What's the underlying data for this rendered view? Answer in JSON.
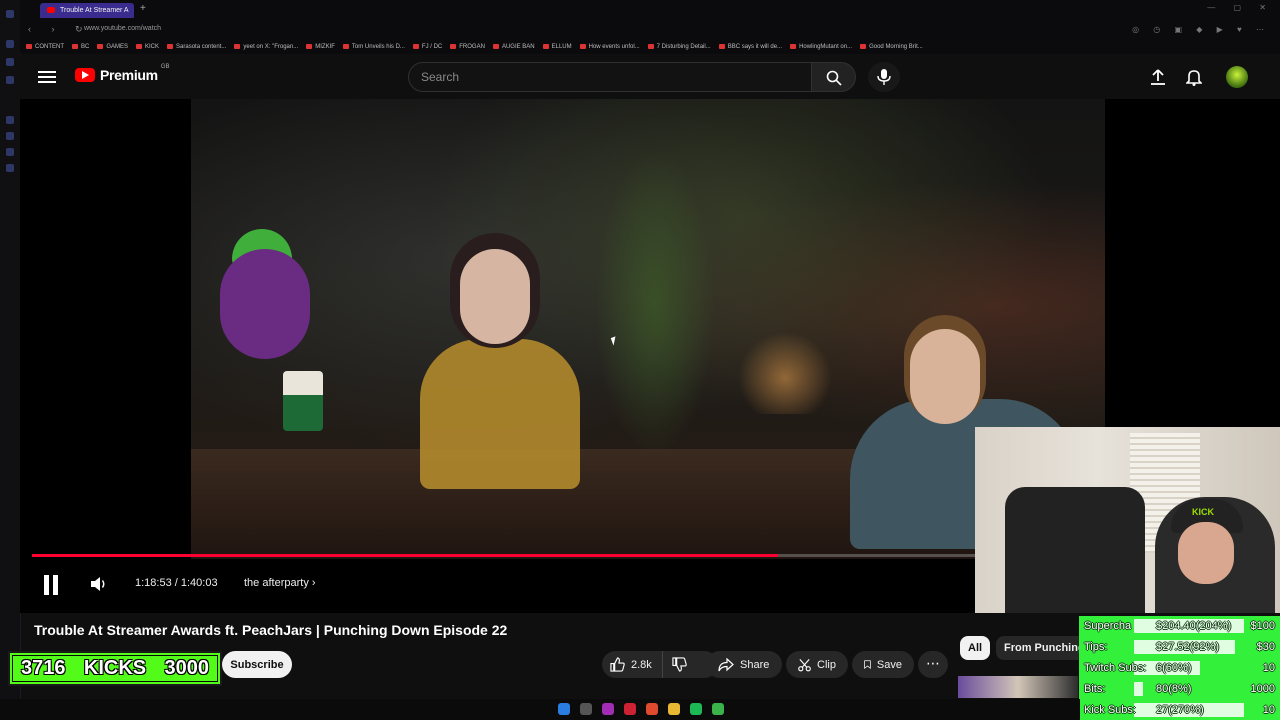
{
  "browser": {
    "tab_title": "Trouble At Streamer A",
    "url": "www.youtube.com/watch",
    "bookmarks": [
      "CONTENT",
      "BC",
      "GAMES",
      "KICK",
      "Sarasota content...",
      "yeet on X: \"Frogan...",
      "MIZKIF",
      "Tom Unveils his D...",
      "FJ / DC",
      "FROGAN",
      "AUGIE BAN",
      "ELLUM",
      "How events unfol...",
      "7 Disturbing Detail...",
      "BBC says it will de...",
      "HowlingMutant on...",
      "Good Morning Brit..."
    ]
  },
  "masthead": {
    "brand": "Premium",
    "region": "GB",
    "search_placeholder": "Search"
  },
  "player": {
    "time": "1:18:53 / 1:40:03",
    "chapter": "the afterparty",
    "progress_fraction": 0.79,
    "webcam_cap_text": "KICK"
  },
  "video": {
    "title": "Trouble At Streamer Awards ft. PeachJars | Punching Down Episode 22",
    "subscribe_label": "Subscribe",
    "likes": "2.8k",
    "share_label": "Share",
    "clip_label": "Clip",
    "save_label": "Save"
  },
  "kicks_widget": {
    "count": "3716",
    "label": "KICKS",
    "goal": "3000"
  },
  "chips": {
    "all": "All",
    "from": "From Punching Down"
  },
  "stats": [
    {
      "label": "Supercha",
      "value": "$204.40(204%)",
      "goal": "$100",
      "fraction": 1.0
    },
    {
      "label": "Tips:",
      "value": "$27.52(92%)",
      "goal": "$30",
      "fraction": 0.92
    },
    {
      "label": "Twitch Subs:",
      "value": "6(60%)",
      "goal": "10",
      "fraction": 0.6
    },
    {
      "label": "Bits:",
      "value": "80(8%)",
      "goal": "1000",
      "fraction": 0.08
    },
    {
      "label": "Kick Subs:",
      "value": "27(270%)",
      "goal": "10",
      "fraction": 1.0
    }
  ],
  "colors": {
    "yt_red": "#ff0000",
    "progress_red": "#ff0033",
    "kick_green": "#53fc18",
    "stats_green": "#33f03b"
  }
}
